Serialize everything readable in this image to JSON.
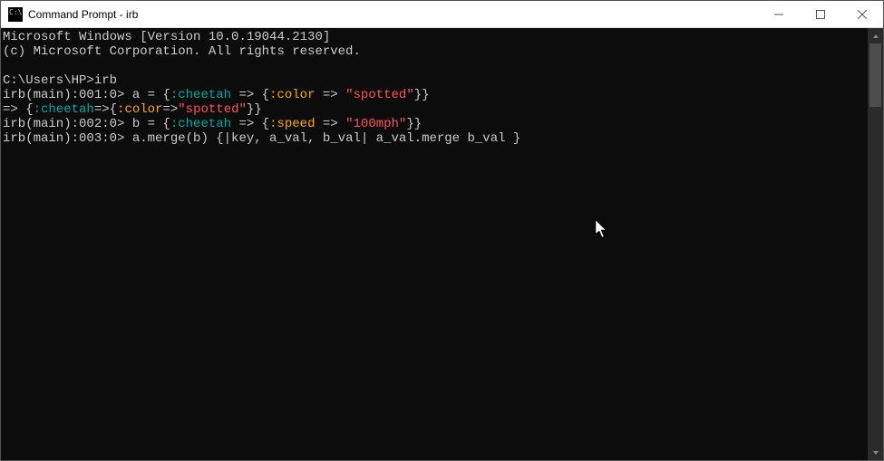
{
  "window": {
    "title": "Command Prompt - irb",
    "controls": {
      "minimize": "—",
      "maximize": "▢",
      "close": "✕"
    }
  },
  "terminal": {
    "header1": "Microsoft Windows [Version 10.0.19044.2130]",
    "header2": "(c) Microsoft Corporation. All rights reserved.",
    "blank": "",
    "cmdline": "C:\\Users\\HP>irb",
    "l1_prompt": "irb(main):001:0> ",
    "l1_a": "a = {",
    "l1_sym": ":cheetah",
    "l1_b": " => {",
    "l1_key": ":color",
    "l1_c": " => ",
    "l1_str": "\"spotted\"",
    "l1_d": "}}",
    "l2_a": "=> {",
    "l2_sym": ":cheetah",
    "l2_b": "=>{",
    "l2_key": ":color",
    "l2_c": "=>",
    "l2_str": "\"spotted\"",
    "l2_d": "}}",
    "l3_prompt": "irb(main):002:0> ",
    "l3_a": "b = {",
    "l3_sym": ":cheetah",
    "l3_b": " => {",
    "l3_key": ":speed",
    "l3_c": " => ",
    "l3_str": "\"100mph\"",
    "l3_d": "}}",
    "l4_prompt": "irb(main):003:0> ",
    "l4_code": "a.merge(b) {|key, a_val, b_val| a_val.merge b_val }"
  }
}
